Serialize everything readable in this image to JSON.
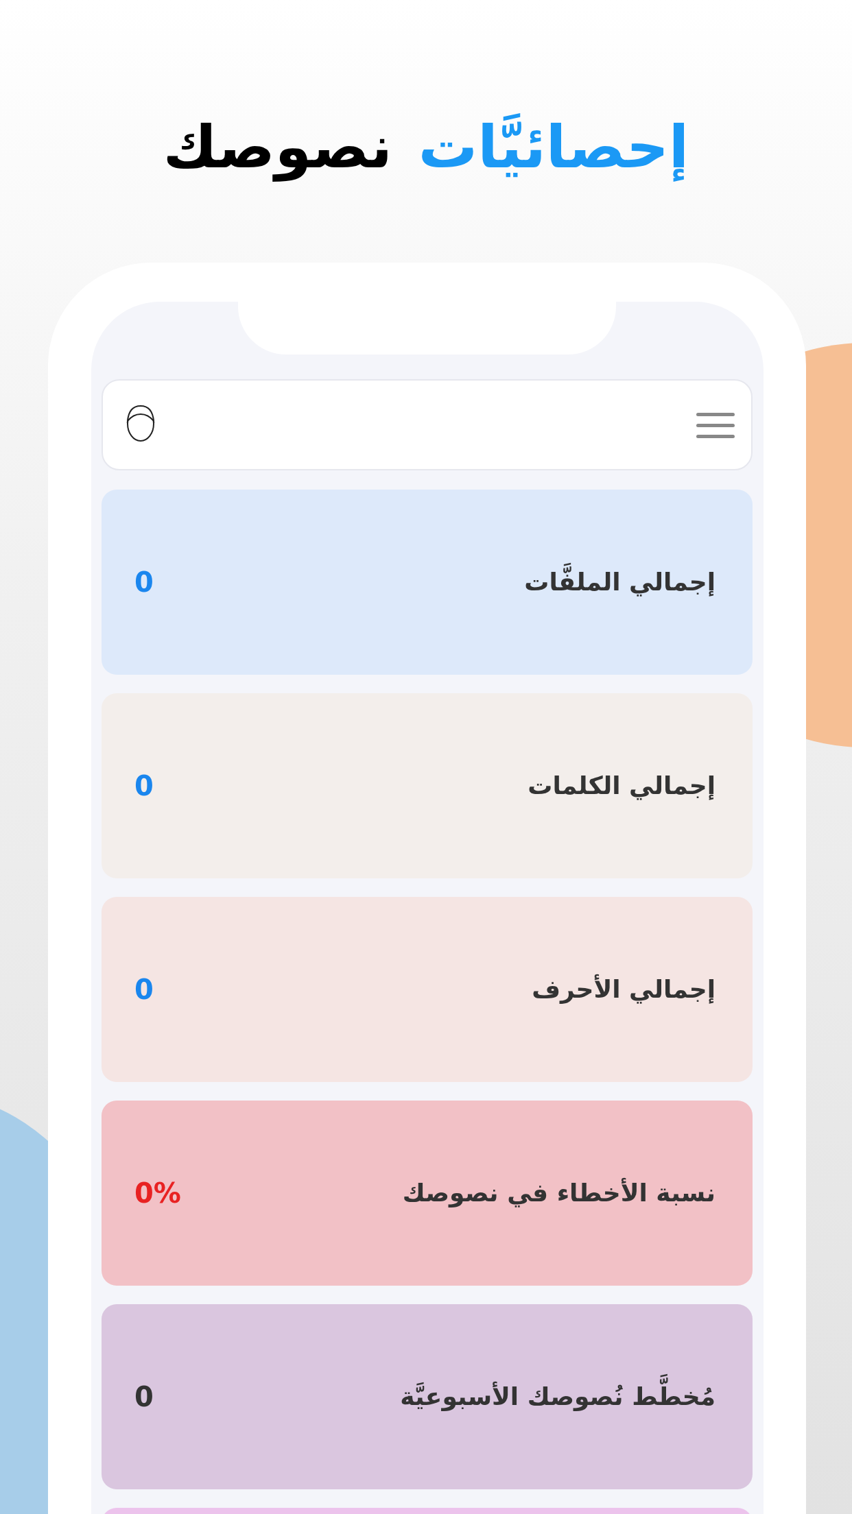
{
  "headline": [
    {
      "text": "إحصائيَّات",
      "highlight": true
    },
    {
      "text": "نصوصك",
      "highlight": false
    }
  ],
  "cards": [
    {
      "label": "إجمالي الملفَّات",
      "value": "0",
      "color": "#dde9fa",
      "kind": "count"
    },
    {
      "label": "إجمالي  الكلمات",
      "value": "0",
      "color": "#f3eeeb",
      "kind": "count"
    },
    {
      "label": "إجمالي  الأحرف",
      "value": "0",
      "color": "#f5e5e3",
      "kind": "count"
    },
    {
      "label": "نسبة الأخطاء في نصوصك",
      "value": "0%",
      "color": "#f2c1c6",
      "kind": "percent"
    },
    {
      "label": "مُخطَّط نُصوصك الأسبوعيَّة",
      "value": "0",
      "color": "#dac6df",
      "kind": "chart"
    },
    {
      "color": "#ecc3ec"
    }
  ]
}
